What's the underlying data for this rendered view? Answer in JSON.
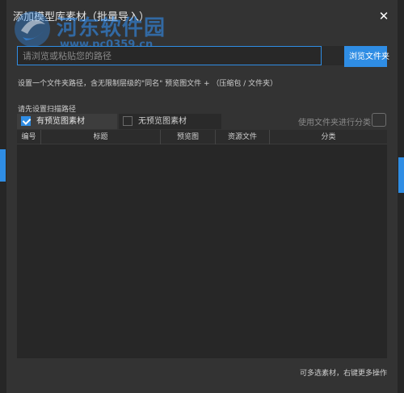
{
  "dialog": {
    "title": "添加模型库素材（批量导入）",
    "close_glyph": "✕"
  },
  "watermark": {
    "text": "河东软件园",
    "url": "www.pc0359.cn"
  },
  "path": {
    "placeholder": "请浏览或粘贴您的路径",
    "value": ""
  },
  "browse_button": "浏览文件夹",
  "hint": "设置一个文件夹路径，含无限制层级的\"同名\" 预览图文件 + （压缩包 / 文件夹）",
  "scan_label": "请先设置扫描路径",
  "tabs": [
    {
      "label": "有预览图素材",
      "checked": true
    },
    {
      "label": "无预览图素材",
      "checked": false
    }
  ],
  "folder_category": {
    "label": "使用文件夹进行分类",
    "checked": false
  },
  "table": {
    "columns": [
      "编号",
      "标题",
      "预览图",
      "资源文件",
      "分类"
    ],
    "rows": []
  },
  "footer_note": "可多选素材，右键更多操作",
  "colors": {
    "accent": "#2f8de4",
    "dialog_bg": "#333333",
    "table_bg": "#272727"
  }
}
